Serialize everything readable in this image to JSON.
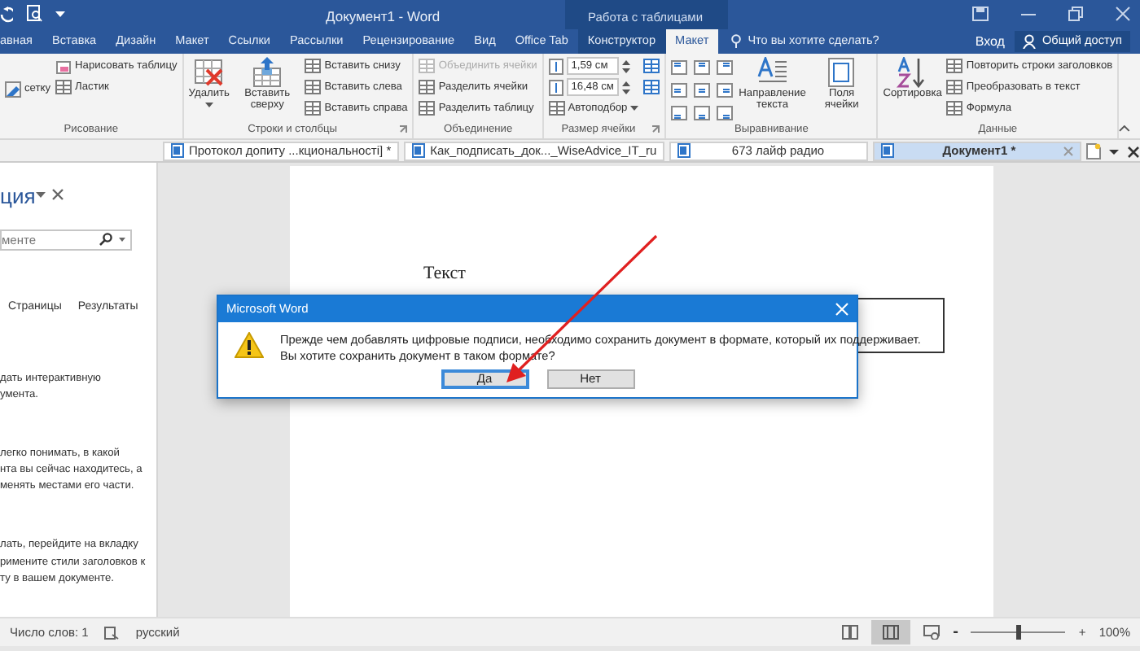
{
  "window": {
    "title": "Документ1 - Word",
    "context_title": "Работа с таблицами"
  },
  "ribbon_tabs": [
    {
      "label": "авная",
      "selected": false,
      "contextual": false
    },
    {
      "label": "Вставка",
      "selected": false,
      "contextual": false
    },
    {
      "label": "Дизайн",
      "selected": false,
      "contextual": false
    },
    {
      "label": "Макет",
      "selected": false,
      "contextual": false
    },
    {
      "label": "Ссылки",
      "selected": false,
      "contextual": false
    },
    {
      "label": "Рассылки",
      "selected": false,
      "contextual": false
    },
    {
      "label": "Рецензирование",
      "selected": false,
      "contextual": false
    },
    {
      "label": "Вид",
      "selected": false,
      "contextual": false
    },
    {
      "label": "Office Tab",
      "selected": false,
      "contextual": false
    },
    {
      "label": "Конструктор",
      "selected": false,
      "contextual": true
    },
    {
      "label": "Макет",
      "selected": true,
      "contextual": true
    }
  ],
  "tell_me": "Что вы хотите сделать?",
  "sign_in": "Вход",
  "share": "Общий доступ",
  "ribbon_groups": [
    {
      "label": "Рисование",
      "launcher": false,
      "columns": [
        [
          {
            "kind": "small",
            "label": "сетку"
          }
        ],
        [
          {
            "kind": "small",
            "label": "Нарисовать таблицу"
          },
          {
            "kind": "small",
            "label": "Ластик"
          }
        ]
      ]
    },
    {
      "label": "Строки и столбцы",
      "launcher": true,
      "columns": [
        [
          {
            "kind": "large",
            "label": "Удалить",
            "caret": true
          }
        ],
        [
          {
            "kind": "large",
            "label": "Вставить сверху",
            "caret": false
          }
        ],
        [
          {
            "kind": "small",
            "label": "Вставить снизу"
          },
          {
            "kind": "small",
            "label": "Вставить слева"
          },
          {
            "kind": "small",
            "label": "Вставить справа"
          }
        ]
      ]
    },
    {
      "label": "Объединение",
      "launcher": false,
      "columns": [
        [
          {
            "kind": "small",
            "label": "Объединить ячейки",
            "disabled": true
          },
          {
            "kind": "small",
            "label": "Разделить ячейки",
            "disabled": false
          },
          {
            "kind": "small",
            "label": "Разделить таблицу",
            "disabled": false
          }
        ]
      ]
    },
    {
      "label": "Размер ячейки",
      "launcher": true,
      "columns": [
        [
          {
            "kind": "field",
            "value": "1,59 см"
          },
          {
            "kind": "field",
            "value": "16,48 см"
          },
          {
            "kind": "small",
            "label": "Автоподбор",
            "caret": true
          }
        ],
        [
          {
            "kind": "icon_only"
          },
          {
            "kind": "icon_only"
          }
        ]
      ]
    },
    {
      "label": "Выравнивание",
      "launcher": false,
      "columns": [
        [
          {
            "kind": "align_grid"
          }
        ],
        [
          {
            "kind": "large",
            "label": "Направление текста",
            "caret": false
          }
        ],
        [
          {
            "kind": "large",
            "label": "Поля ячейки",
            "caret": false
          }
        ]
      ]
    },
    {
      "label": "Данные",
      "launcher": false,
      "columns": [
        [
          {
            "kind": "large",
            "label": "Сортировка",
            "caret": false
          }
        ],
        [
          {
            "kind": "small",
            "label": "Повторить строки заголовков"
          },
          {
            "kind": "small",
            "label": "Преобразовать в текст"
          },
          {
            "kind": "small",
            "label": "Формула"
          }
        ]
      ]
    }
  ],
  "doc_tabs": [
    {
      "label": "Протокол допиту ...кциональності] *",
      "selected": false
    },
    {
      "label": "Как_подписать_док..._WiseAdvice_IT_ru",
      "selected": false
    },
    {
      "label": "673 лайф радио",
      "selected": false
    },
    {
      "label": "Документ1 *",
      "selected": true
    }
  ],
  "nav_pane": {
    "title": "ция",
    "search_placeholder": "менте",
    "tabs": [
      {
        "label": "Страницы",
        "selected": false
      },
      {
        "label": "Результаты",
        "selected": false
      }
    ],
    "paragraphs": [
      [
        "дать интерактивную",
        "умента."
      ],
      [
        "легко понимать, в какой",
        "нта вы сейчас находитесь, а",
        "менять местами его части."
      ],
      [
        "лать, перейдите на вкладку",
        "римените стили заголовков к",
        "ту в вашем документе."
      ]
    ]
  },
  "document": {
    "text": "Текст"
  },
  "dialog": {
    "title": "Microsoft Word",
    "message": [
      "Прежде чем добавлять цифровые подписи, необходимо сохранить документ в формате, который их поддерживает.",
      "Вы хотите сохранить документ в таком формате?"
    ],
    "buttons": [
      {
        "label": "Да",
        "selected": true
      },
      {
        "label": "Нет",
        "selected": false
      }
    ]
  },
  "status_bar": {
    "word_count": "Число слов: 1",
    "language": "русский",
    "zoom_minus": "-",
    "zoom_plus": "+",
    "zoom": "100%",
    "zoom_slider": {
      "level": 0.5
    }
  }
}
